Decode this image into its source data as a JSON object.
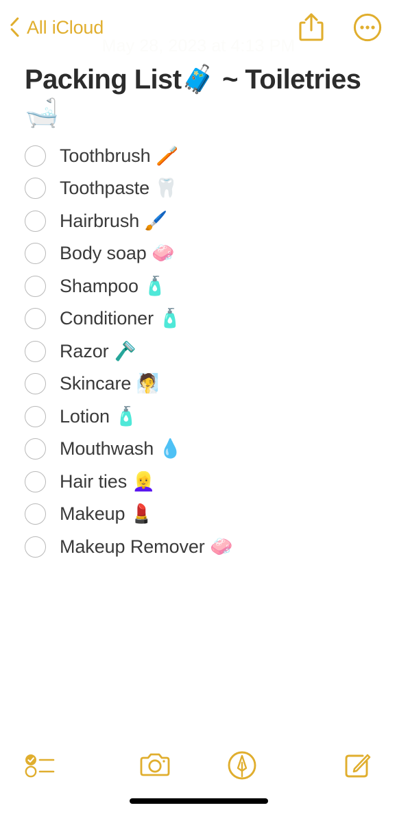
{
  "accent_color": "#e0ae2e",
  "text_color": "#3a3a3a",
  "title_color": "#2c2c2c",
  "navbar": {
    "back_label": "All iCloud",
    "back_icon": "chevron-left-icon",
    "share_icon": "share-icon",
    "more_icon": "more-options-icon",
    "date_stamp": "May 28, 2023 at 4:13 PM"
  },
  "note": {
    "title": "Packing List🧳 ~ Toiletries 🛁",
    "checklist": [
      {
        "label": "Toothbrush 🪥",
        "checked": false
      },
      {
        "label": "Toothpaste 🦷",
        "checked": false
      },
      {
        "label": "Hairbrush 🖌️",
        "checked": false
      },
      {
        "label": "Body soap 🧼",
        "checked": false
      },
      {
        "label": "Shampoo 🧴",
        "checked": false
      },
      {
        "label": "Conditioner 🧴",
        "checked": false
      },
      {
        "label": "Razor 🪒",
        "checked": false
      },
      {
        "label": "Skincare 🧖",
        "checked": false
      },
      {
        "label": "Lotion 🧴",
        "checked": false
      },
      {
        "label": "Mouthwash 💧",
        "checked": false
      },
      {
        "label": "Hair ties 👱‍♀️",
        "checked": false
      },
      {
        "label": "Makeup 💄",
        "checked": false
      },
      {
        "label": "Makeup Remover 🧼",
        "checked": false
      }
    ]
  },
  "toolbar": {
    "checklist_icon": "checklist-icon",
    "camera_icon": "camera-icon",
    "markup_icon": "markup-pen-icon",
    "compose_icon": "compose-icon"
  }
}
